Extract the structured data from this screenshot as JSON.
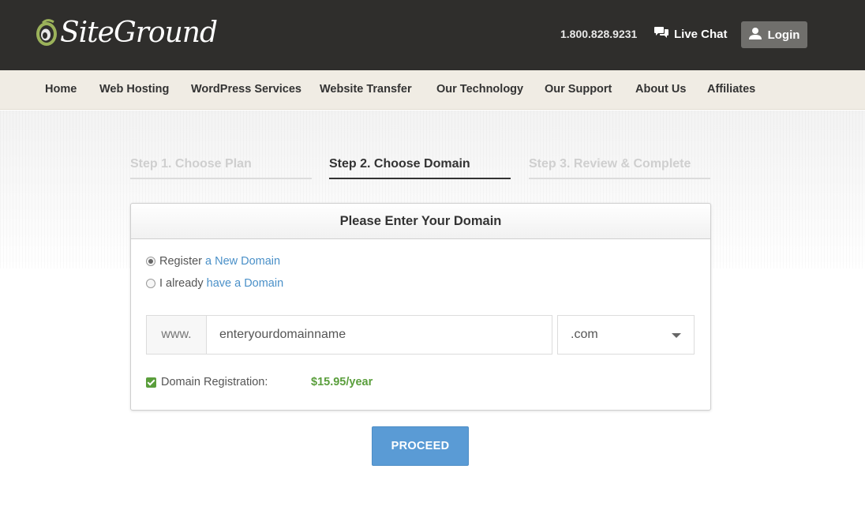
{
  "header": {
    "brand": "SiteGround",
    "phone": "1.800.828.9231",
    "live_chat": "Live Chat",
    "login": "Login"
  },
  "nav": {
    "items": [
      {
        "label": "Home"
      },
      {
        "label": "Web Hosting"
      },
      {
        "label": "WordPress Services"
      },
      {
        "label": "Website Transfer"
      },
      {
        "label": "Our Technology"
      },
      {
        "label": "Our Support"
      },
      {
        "label": "About Us"
      },
      {
        "label": "Affiliates"
      }
    ]
  },
  "steps": [
    {
      "label": "Step 1. Choose Plan",
      "state": "inactive"
    },
    {
      "label": "Step 2. Choose Domain",
      "state": "active"
    },
    {
      "label": "Step 3. Review & Complete",
      "state": "inactive"
    }
  ],
  "panel": {
    "title": "Please Enter Your Domain",
    "options": [
      {
        "prefix": "Register",
        "link": "a New Domain",
        "selected": true
      },
      {
        "prefix": "I already",
        "link": "have a Domain",
        "selected": false
      }
    ],
    "www_prefix": "www.",
    "domain_value": "enteryourdomainname",
    "tld_selected": ".com",
    "registration_label": "Domain Registration:",
    "registration_checked": true,
    "price": "$15.95/year"
  },
  "actions": {
    "proceed": "PROCEED"
  },
  "colors": {
    "header_bg": "#2f2e2c",
    "nav_bg": "#f0ece4",
    "accent_blue": "#5a9bd5",
    "link_blue": "#4a90c8",
    "price_green": "#5a9e3c"
  },
  "icons": [
    "siteground-logo-icon",
    "chat-bubbles-icon",
    "user-icon",
    "chevron-down-icon",
    "checkmark-icon"
  ]
}
